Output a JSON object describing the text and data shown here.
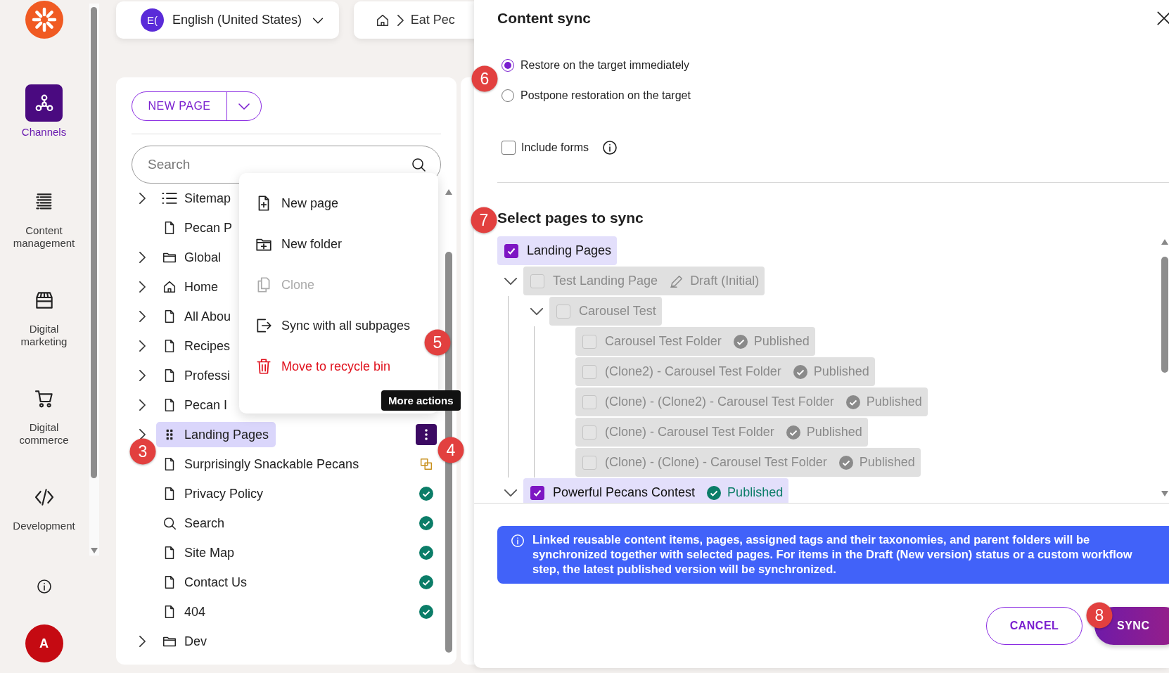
{
  "nav": {
    "items": [
      {
        "label": "Channels",
        "selected": true
      },
      {
        "label": "Content management",
        "selected": false
      },
      {
        "label": "Digital marketing",
        "selected": false
      },
      {
        "label": "Digital commerce",
        "selected": false
      },
      {
        "label": "Development",
        "selected": false
      }
    ],
    "avatar": "A"
  },
  "language": {
    "badge": "E(",
    "label": "English (United States)"
  },
  "breadcrumb": [
    "Eat Pec"
  ],
  "pages_panel": {
    "new_button": "NEW PAGE",
    "search": {
      "placeholder": "Search"
    },
    "tree": [
      {
        "label": "Sitemap",
        "kind": "list",
        "has_children": true,
        "selected": false,
        "published": false,
        "modified": false
      },
      {
        "label": "Pecan P",
        "kind": "page",
        "has_children": false,
        "selected": false,
        "published": false,
        "modified": false
      },
      {
        "label": "Global",
        "kind": "folder",
        "has_children": true,
        "selected": false,
        "published": false,
        "modified": false
      },
      {
        "label": "Home",
        "kind": "home",
        "has_children": true,
        "selected": false,
        "published": false,
        "modified": false
      },
      {
        "label": "All Abou",
        "kind": "page",
        "has_children": true,
        "selected": false,
        "published": false,
        "modified": false
      },
      {
        "label": "Recipes",
        "kind": "page",
        "has_children": true,
        "selected": false,
        "published": false,
        "modified": false
      },
      {
        "label": "Professi",
        "kind": "page",
        "has_children": true,
        "selected": false,
        "published": false,
        "modified": false
      },
      {
        "label": "Pecan I",
        "kind": "page",
        "has_children": true,
        "selected": false,
        "published": false,
        "modified": false
      },
      {
        "label": "Landing Pages",
        "kind": "grid",
        "has_children": true,
        "selected": true,
        "published": false,
        "modified": false
      },
      {
        "label": "Surprisingly Snackable Pecans",
        "kind": "page",
        "has_children": false,
        "selected": false,
        "published": false,
        "modified": true
      },
      {
        "label": "Privacy Policy",
        "kind": "page",
        "has_children": false,
        "selected": false,
        "published": true,
        "modified": false
      },
      {
        "label": "Search",
        "kind": "search",
        "has_children": false,
        "selected": false,
        "published": true,
        "modified": false
      },
      {
        "label": "Site Map",
        "kind": "page",
        "has_children": false,
        "selected": false,
        "published": true,
        "modified": false
      },
      {
        "label": "Contact Us",
        "kind": "page",
        "has_children": false,
        "selected": false,
        "published": true,
        "modified": false
      },
      {
        "label": "404",
        "kind": "page",
        "has_children": false,
        "selected": false,
        "published": true,
        "modified": false
      },
      {
        "label": "Dev",
        "kind": "folder",
        "has_children": true,
        "selected": false,
        "published": false,
        "modified": false
      }
    ],
    "menu": [
      {
        "label": "New page",
        "kind": "new-page",
        "disabled": false
      },
      {
        "label": "New folder",
        "kind": "new-folder",
        "disabled": false
      },
      {
        "label": "Clone",
        "kind": "clone",
        "disabled": true
      },
      {
        "label": "Sync with all subpages",
        "kind": "sync",
        "disabled": false
      },
      {
        "label": "Move to recycle bin",
        "kind": "delete",
        "disabled": false
      }
    ],
    "tooltip": "More actions"
  },
  "dialog": {
    "title": "Content sync",
    "restore_options": [
      {
        "label": "Restore on the target immediately",
        "selected": true
      },
      {
        "label": "Postpone restoration on the target",
        "selected": false
      }
    ],
    "include_forms": {
      "label": "Include forms",
      "checked": false
    },
    "pages_heading": "Select pages to sync",
    "pages": [
      {
        "label": "Landing Pages",
        "checked": true,
        "disabled": false,
        "children": [
          {
            "label": "Test Landing Page",
            "checked": false,
            "disabled": true,
            "expanded": true,
            "status": {
              "label": "Draft (Initial)",
              "kind": "draft"
            },
            "children": [
              {
                "label": "Carousel Test",
                "checked": false,
                "disabled": true,
                "expanded": true,
                "children": [
                  {
                    "label": "Carousel Test Folder",
                    "checked": false,
                    "disabled": true,
                    "status": {
                      "label": "Published",
                      "kind": "published"
                    }
                  },
                  {
                    "label": "(Clone2) - Carousel Test Folder",
                    "checked": false,
                    "disabled": true,
                    "status": {
                      "label": "Published",
                      "kind": "published"
                    }
                  },
                  {
                    "label": "(Clone) - (Clone2) - Carousel Test Folder",
                    "checked": false,
                    "disabled": true,
                    "status": {
                      "label": "Published",
                      "kind": "published"
                    }
                  },
                  {
                    "label": "(Clone) - Carousel Test Folder",
                    "checked": false,
                    "disabled": true,
                    "status": {
                      "label": "Published",
                      "kind": "published"
                    }
                  },
                  {
                    "label": "(Clone) - (Clone) - Carousel Test Folder",
                    "checked": false,
                    "disabled": true,
                    "status": {
                      "label": "Published",
                      "kind": "published"
                    }
                  }
                ]
              }
            ]
          },
          {
            "label": "Powerful Pecans Contest",
            "checked": true,
            "disabled": false,
            "expanded": true,
            "status": {
              "label": "Published",
              "kind": "published"
            }
          }
        ]
      }
    ],
    "notice": "Linked reusable content items, pages, assigned tags and their taxonomies, and parent folders will be synchronized together with selected pages. For items in the Draft (New version) status or a custom workflow step, the latest published version will be synchronized.",
    "buttons": [
      {
        "label": "CANCEL",
        "kind": "secondary"
      },
      {
        "label": "SYNC",
        "kind": "primary"
      }
    ]
  },
  "callouts": [
    "3",
    "4",
    "5",
    "6",
    "7",
    "8"
  ]
}
